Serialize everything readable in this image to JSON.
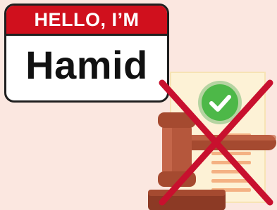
{
  "name_tag": {
    "greeting": "HELLO, I’M",
    "name": "Hamid"
  },
  "icons": {
    "gavel": "gavel-icon",
    "document": "legal-document-icon",
    "check": "check-circle-icon",
    "cross": "red-x-cross-icon"
  },
  "colors": {
    "background": "#fbe7e0",
    "tag_red": "#d0101d",
    "gavel_brown": "#b5573c",
    "document_paper": "#fdf2d6",
    "document_lines": "#f4b183",
    "check_green": "#4db848",
    "cross_red": "#c8102e"
  }
}
